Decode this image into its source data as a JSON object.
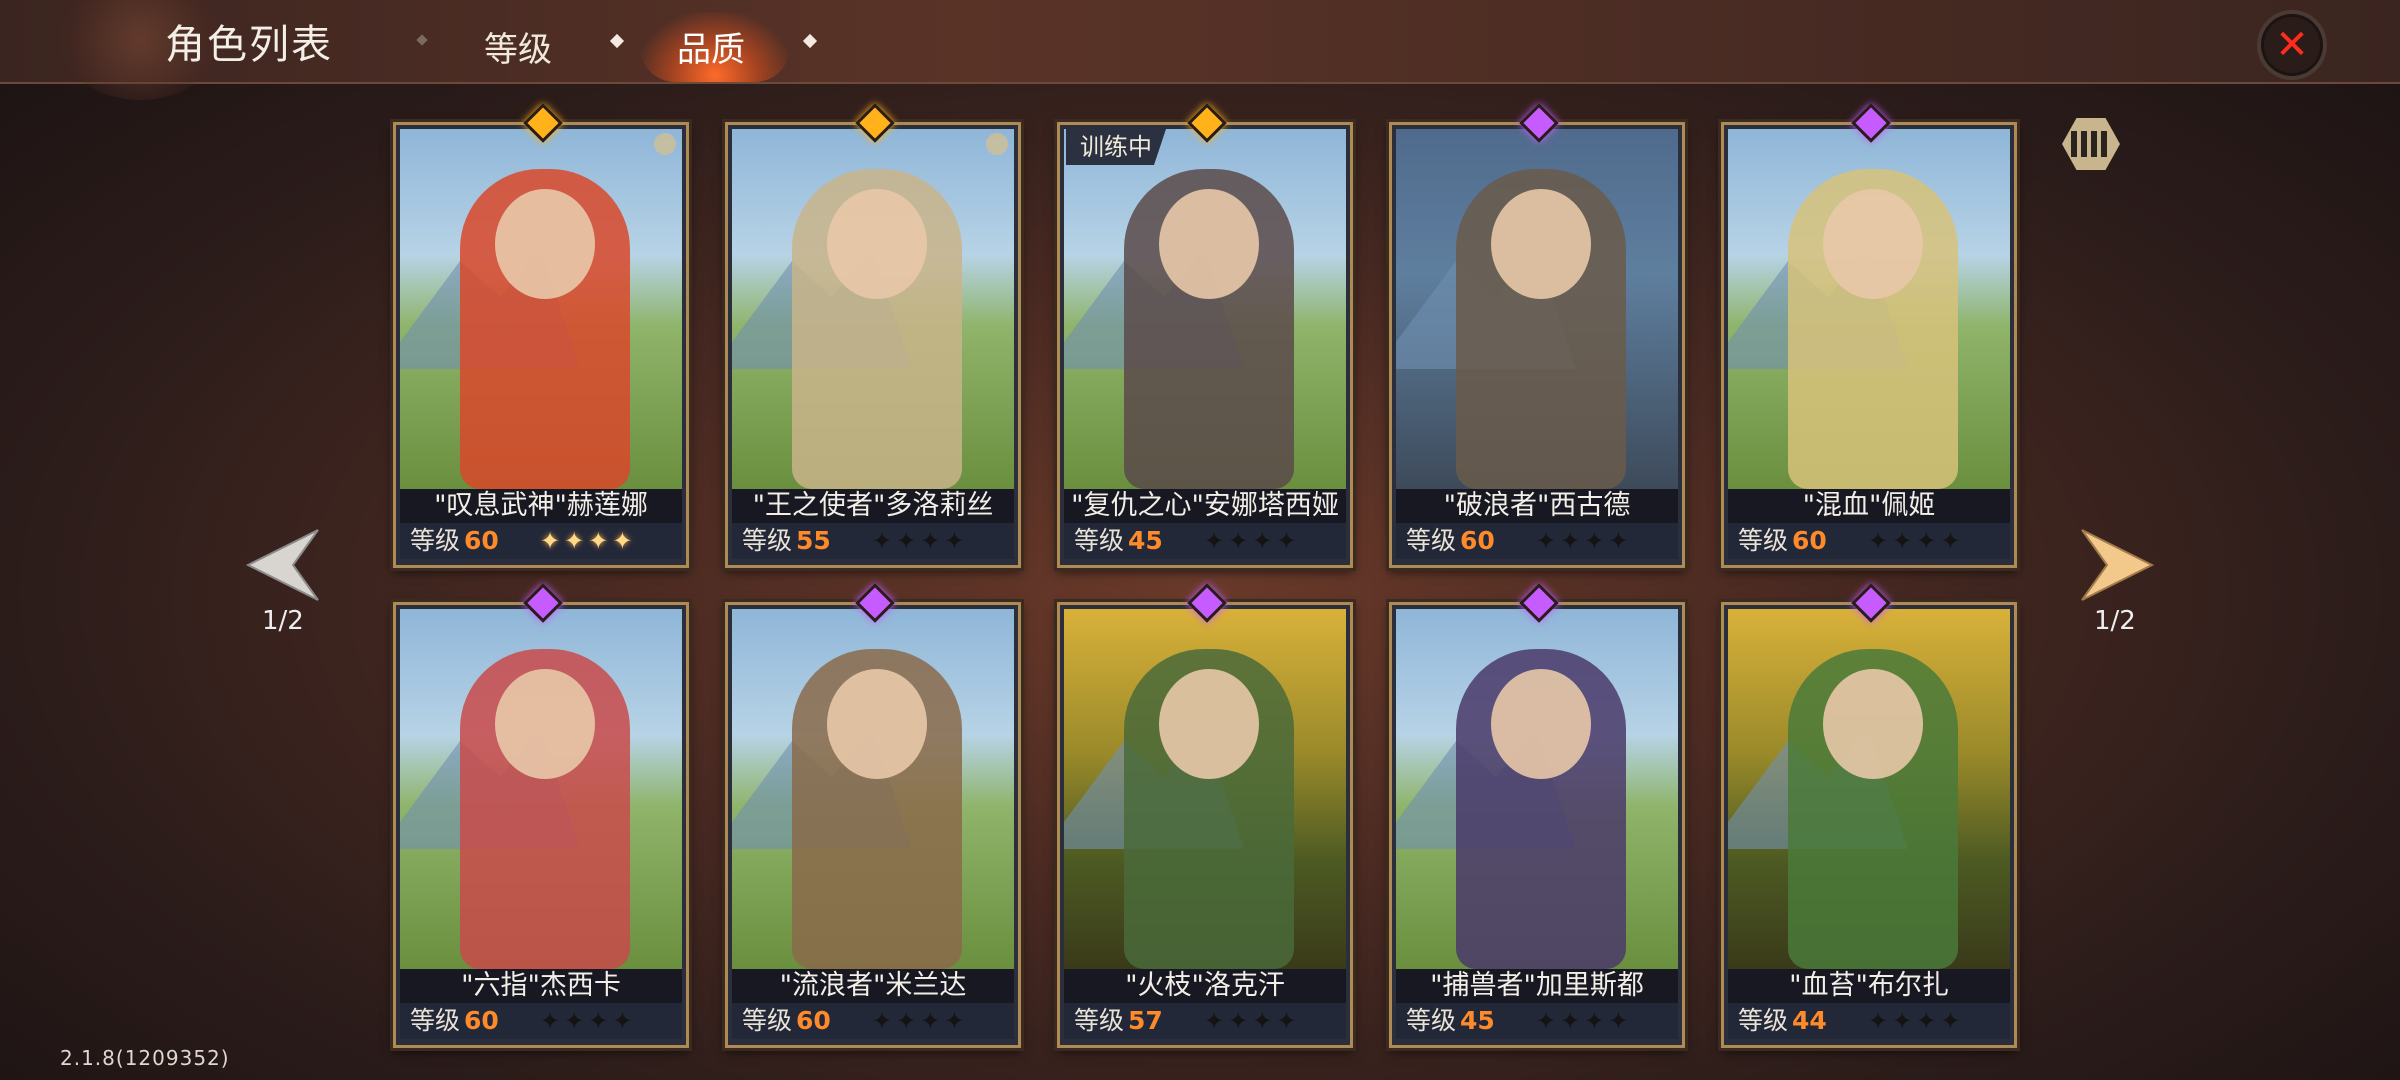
{
  "header": {
    "title": "角色列表",
    "tabs": [
      {
        "label": "等级",
        "active": false
      },
      {
        "label": "品质",
        "active": true
      }
    ],
    "close_icon": "close-icon"
  },
  "colors": {
    "level_value": "#ff8a2a",
    "gem_gold": "#ffb21a",
    "gem_purple": "#c65bff",
    "close": "#ff2b1c"
  },
  "level_prefix": "等级",
  "cards": [
    {
      "name": "\"叹息武神\"赫莲娜",
      "level": "60",
      "stars_on": 4,
      "gem": "gold",
      "badge": ""
    },
    {
      "name": "\"王之使者\"多洛莉丝",
      "level": "55",
      "stars_on": 0,
      "gem": "gold",
      "badge": ""
    },
    {
      "name": "\"复仇之心\"安娜塔西娅",
      "level": "45",
      "stars_on": 0,
      "gem": "gold",
      "badge": "训练中"
    },
    {
      "name": "\"破浪者\"西古德",
      "level": "60",
      "stars_on": 0,
      "gem": "purple",
      "badge": ""
    },
    {
      "name": "\"混血\"佩姬",
      "level": "60",
      "stars_on": 0,
      "gem": "purple",
      "badge": ""
    },
    {
      "name": "\"六指\"杰西卡",
      "level": "60",
      "stars_on": 0,
      "gem": "purple",
      "badge": ""
    },
    {
      "name": "\"流浪者\"米兰达",
      "level": "60",
      "stars_on": 0,
      "gem": "purple",
      "badge": ""
    },
    {
      "name": "\"火枝\"洛克汗",
      "level": "57",
      "stars_on": 0,
      "gem": "purple",
      "badge": ""
    },
    {
      "name": "\"捕兽者\"加里斯都",
      "level": "45",
      "stars_on": 0,
      "gem": "purple",
      "badge": ""
    },
    {
      "name": "\"血苔\"布尔扎",
      "level": "44",
      "stars_on": 0,
      "gem": "purple",
      "badge": ""
    }
  ],
  "pagination": {
    "left": "1/2",
    "right": "1/2"
  },
  "version": "2.1.8(1209352)"
}
